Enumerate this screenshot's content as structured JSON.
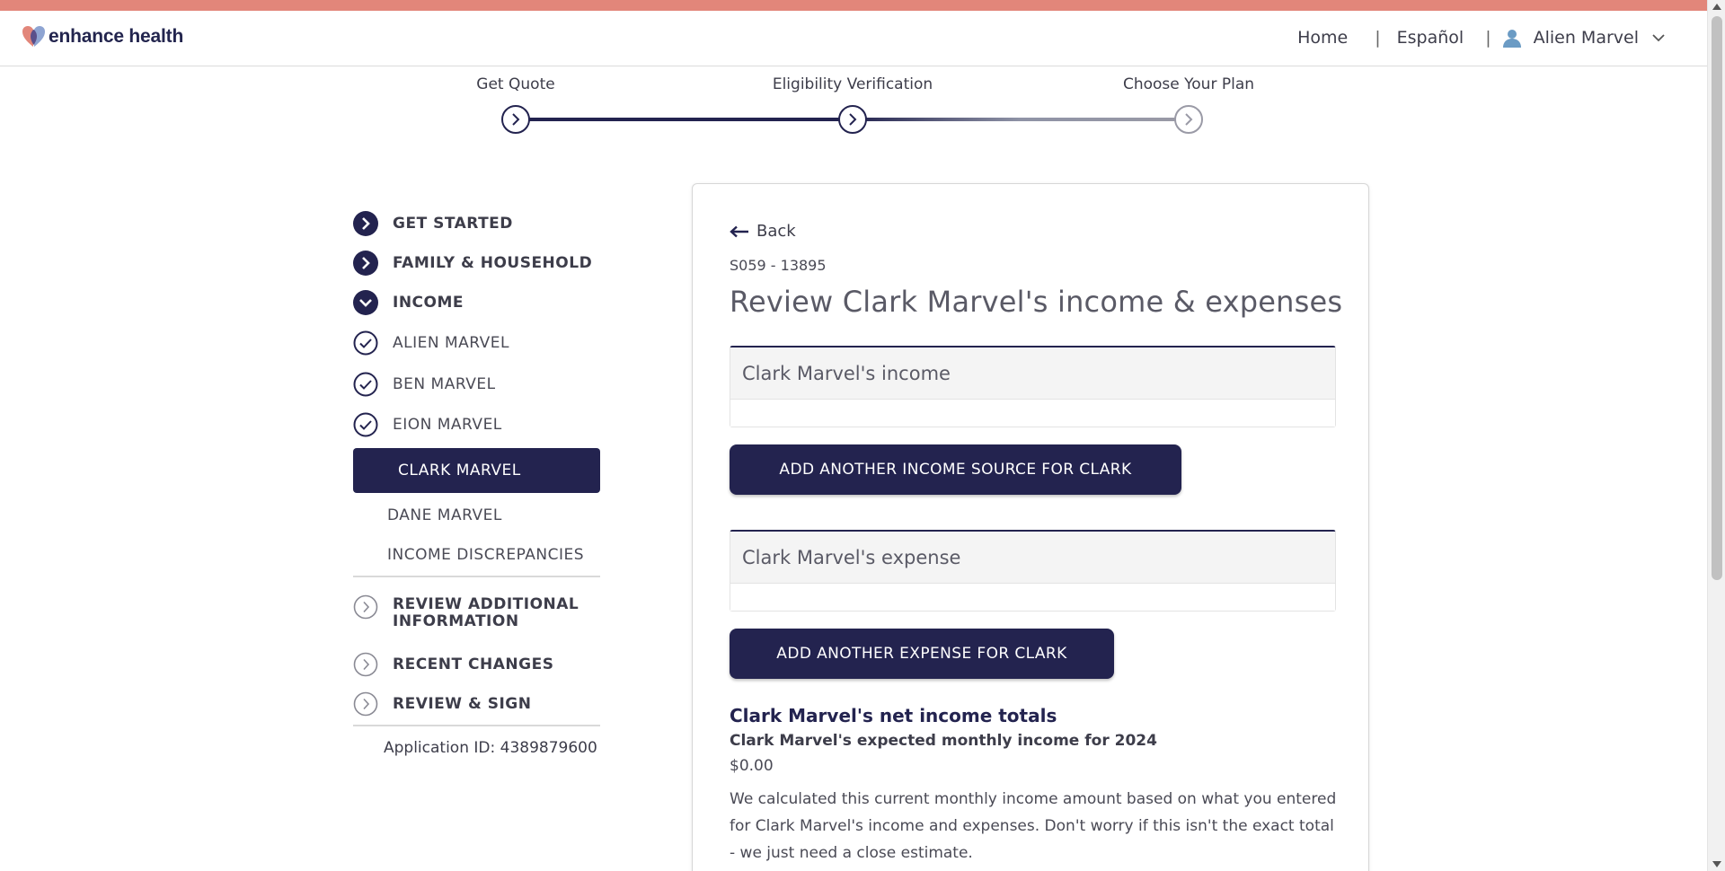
{
  "header": {
    "brand": "enhance health",
    "nav": {
      "home": "Home",
      "language": "Español",
      "separator": "|",
      "user_name": "Alien Marvel"
    }
  },
  "stepper": {
    "steps": [
      {
        "label": "Get Quote",
        "state": "complete"
      },
      {
        "label": "Eligibility Verification",
        "state": "current"
      },
      {
        "label": "Choose Your Plan",
        "state": "upcoming"
      }
    ],
    "colors": {
      "active": "#23234f",
      "inactive": "#9a9aa6"
    }
  },
  "sidebar": {
    "sections": [
      {
        "label": "GET STARTED",
        "icon": "chevron-right-filled-icon"
      },
      {
        "label": "FAMILY & HOUSEHOLD",
        "icon": "chevron-right-filled-icon"
      },
      {
        "label": "INCOME",
        "icon": "chevron-down-filled-icon"
      }
    ],
    "income_members": [
      {
        "label": "ALIEN MARVEL",
        "icon": "check-circle-icon"
      },
      {
        "label": "BEN MARVEL",
        "icon": "check-circle-icon"
      },
      {
        "label": "EION MARVEL",
        "icon": "check-circle-icon"
      }
    ],
    "active_item": "CLARK MARVEL",
    "pending_items": [
      "DANE MARVEL",
      "INCOME DISCREPANCIES"
    ],
    "later_sections": [
      {
        "label_line1": "REVIEW ADDITIONAL",
        "label_line2": "INFORMATION",
        "icon": "chevron-right-outline-icon"
      },
      {
        "label": "RECENT CHANGES",
        "icon": "chevron-right-outline-icon"
      },
      {
        "label": "REVIEW & SIGN",
        "icon": "chevron-right-outline-icon"
      }
    ],
    "application_id": "Application ID: 4389879600"
  },
  "main": {
    "back_label": "Back",
    "code": "S059 - 13895",
    "title": "Review Clark Marvel's income & expenses",
    "income_panel_title": "Clark Marvel's income",
    "add_income_button": "ADD ANOTHER INCOME SOURCE FOR CLARK",
    "expense_panel_title": "Clark Marvel's expense",
    "add_expense_button": "ADD ANOTHER EXPENSE FOR CLARK",
    "totals": {
      "title": "Clark Marvel's net income totals",
      "subtitle": "Clark Marvel's expected monthly income for 2024",
      "amount": "$0.00",
      "description": "We calculated this current monthly income amount based on what you entered for Clark Marvel's income and expenses. Don't worry if this isn't the exact total - we just need a close estimate."
    }
  },
  "colors": {
    "accent": "#23234f",
    "brand_stripe": "#e2867a"
  }
}
